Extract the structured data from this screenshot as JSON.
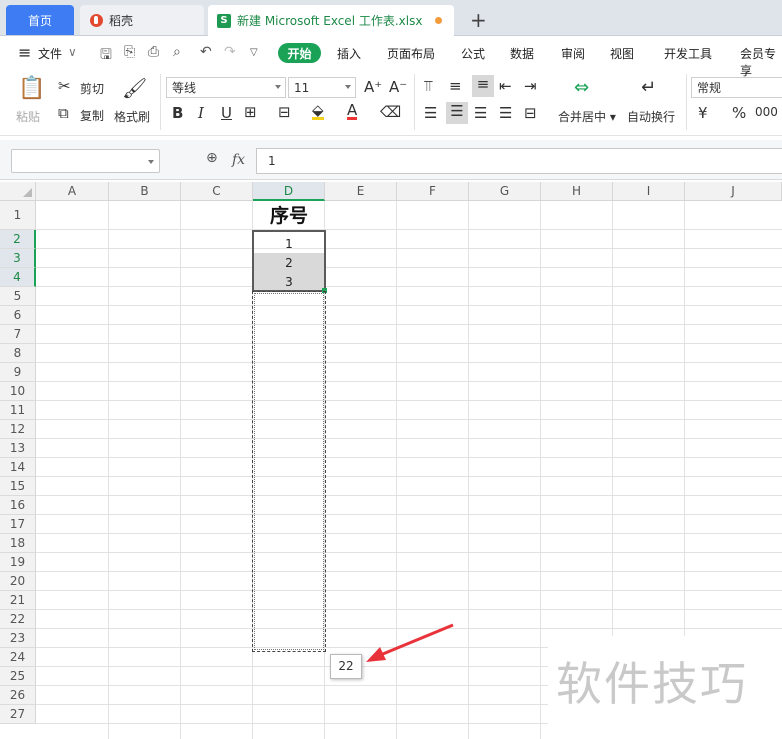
{
  "tabs": {
    "home": "首页",
    "docer": "稻壳",
    "file": "新建 Microsoft Excel 工作表.xlsx",
    "new_tab": "+"
  },
  "menu": {
    "hamburger": "≡",
    "file": "文件",
    "start": "开始",
    "items": [
      "插入",
      "页面布局",
      "公式",
      "数据",
      "审阅",
      "视图",
      "开发工具",
      "会员专享"
    ]
  },
  "ribbon": {
    "paste": "粘贴",
    "cut": "剪切",
    "copy": "复制",
    "format_painter": "格式刷",
    "font_name": "等线",
    "font_size": "11",
    "merge": "合并居中",
    "wrap": "自动换行",
    "number_format": "常规",
    "currency": "¥",
    "percent": "%",
    "thousands": "000"
  },
  "formula_bar": {
    "name_box": "",
    "fx": "fx",
    "value": "1"
  },
  "columns": [
    "A",
    "B",
    "C",
    "D",
    "E",
    "F",
    "G",
    "H",
    "I",
    "J"
  ],
  "selected_column": "D",
  "rows": [
    "1",
    "2",
    "3",
    "4",
    "5",
    "6",
    "7",
    "8",
    "9",
    "10",
    "11",
    "12",
    "13",
    "14",
    "15",
    "16",
    "17",
    "18",
    "19",
    "20",
    "21",
    "22",
    "23",
    "24",
    "25",
    "26",
    "27"
  ],
  "selected_rows": [
    "2",
    "3",
    "4"
  ],
  "cells": {
    "D1": "序号",
    "D2": "1",
    "D3": "2",
    "D4": "3"
  },
  "fill_tooltip": "22",
  "watermark": "软件技巧",
  "colors": {
    "accent_green": "#1aa356",
    "tab_blue": "#3d7cf2",
    "arrow_red": "#e8333a"
  }
}
